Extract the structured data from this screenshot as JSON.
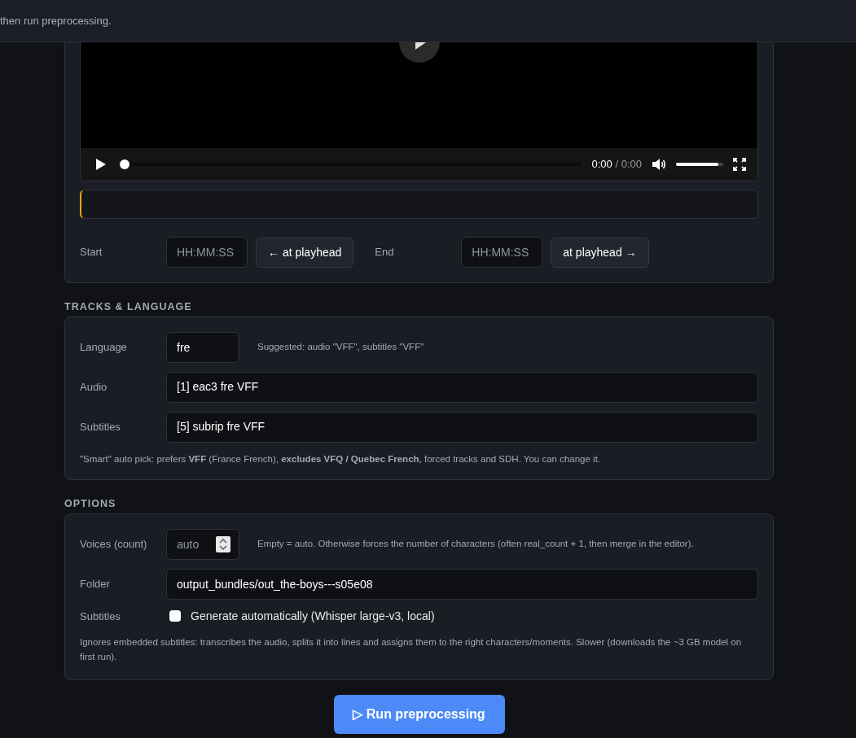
{
  "header": {
    "text": "then run preprocessing."
  },
  "player": {
    "time": "0:00",
    "separator": "/",
    "duration": "0:00",
    "seek": {
      "level": 0
    },
    "volume": {
      "level": 0.9
    }
  },
  "range": {
    "start": {
      "label": "Start",
      "placeholder": "HH:MM:SS",
      "button": "← at playhead"
    },
    "end": {
      "label": "End",
      "placeholder": "HH:MM:SS",
      "button": "at playhead →"
    }
  },
  "tracks": {
    "heading": "TRACKS & LANGUAGE",
    "language": {
      "label": "Language",
      "value": "fre",
      "hint": "Suggested: audio \"VFF\", subtitles \"VFF\""
    },
    "audio": {
      "label": "Audio",
      "value": "[1] eac3 fre VFF"
    },
    "subtitles": {
      "label": "Subtitles",
      "value": "[5] subrip fre VFF"
    },
    "note": "\"Smart\" auto pick: prefers **VFF** (France French), **excludes VFQ / Quebec French**, forced tracks and SDH. You can change it."
  },
  "options": {
    "heading": "OPTIONS",
    "voices": {
      "label": "Voices (count)",
      "placeholder": "auto",
      "hint": "Empty = auto. Otherwise forces the number of characters (often real_count + 1, then merge in the editor)."
    },
    "folder": {
      "label": "Folder",
      "value": "output_bundles/out_the-boys---s05e08"
    },
    "subtitles": {
      "label": "Subtitles",
      "checkbox_label": "Generate automatically (Whisper large-v3, local)",
      "checked": false
    },
    "note": "Ignores embedded subtitles: transcribes the audio, splits it into lines and assigns them to the right characters/moments. Slower (downloads the ~3 GB model on first run)."
  },
  "run_button": {
    "icon": "▷",
    "label": "Run preprocessing"
  }
}
